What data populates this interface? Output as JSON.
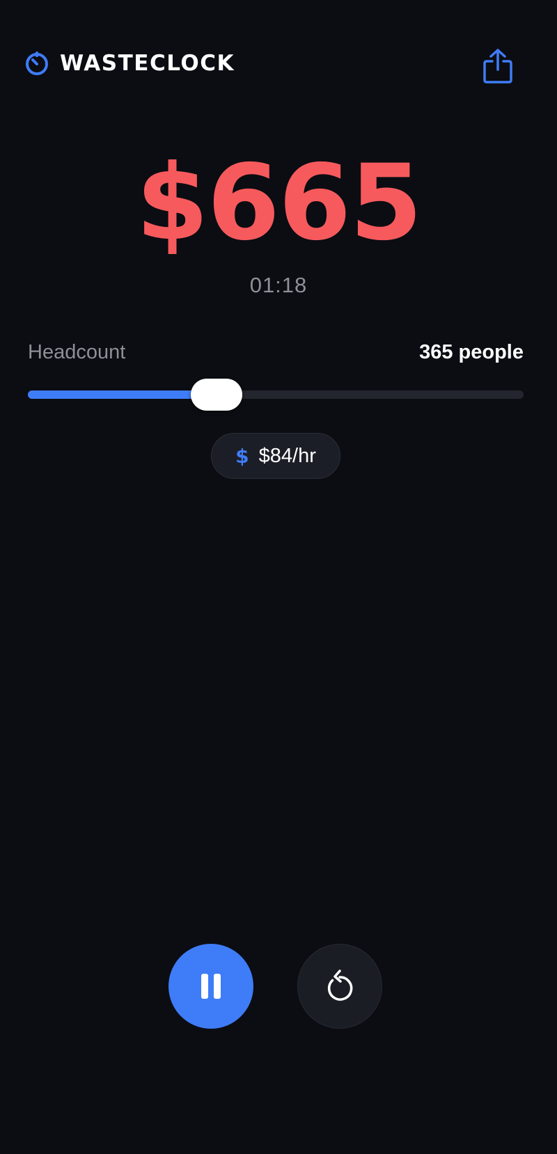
{
  "app": {
    "name": "WASTECLOCK"
  },
  "colors": {
    "background": "#0b0d12",
    "accent": "#3f7cf7",
    "amount": "#f75a5d",
    "muted": "#8d9099",
    "chip": "#1b1e26"
  },
  "icons": {
    "brand": "stopwatch-icon",
    "share": "share-icon",
    "rate": "dollar-icon",
    "pause": "pause-icon",
    "reset": "reset-icon"
  },
  "cost": {
    "amount": "$665",
    "elapsed": "01:18"
  },
  "headcount": {
    "label": "Headcount",
    "value_text": "365 people",
    "slider_fraction": 0.38
  },
  "rate": {
    "symbol": "$",
    "value": "$84/hr"
  }
}
